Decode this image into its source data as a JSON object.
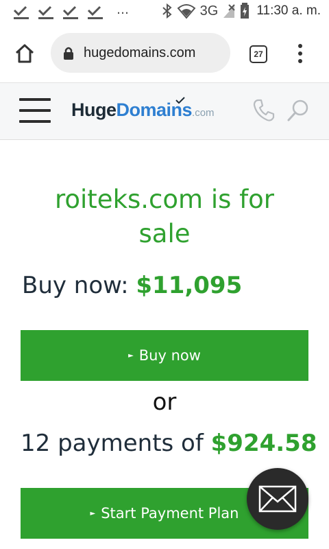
{
  "status_bar": {
    "time": "11:30 a. m.",
    "network": "3G",
    "notification_icons": [
      "download-done-icon",
      "download-done-icon",
      "download-done-icon",
      "download-done-icon"
    ],
    "overflow": "…"
  },
  "browser": {
    "url": "hugedomains.com",
    "tab_count": "27"
  },
  "site_header": {
    "logo_huge": "Huge",
    "logo_domains": "Domains",
    "logo_com": ".com"
  },
  "main": {
    "headline": "roiteks.com is for sale",
    "buy_now_label": "Buy now: ",
    "buy_now_price": "$11,095",
    "buy_button_label": "Buy now",
    "or_label": "or",
    "payments_label": "12 payments of ",
    "payments_price": "$924.58",
    "plan_button_label": "Start Payment Plan"
  },
  "colors": {
    "accent_green": "#2fa12f",
    "logo_blue": "#2e7fd1",
    "text_dark": "#1f2d3a"
  }
}
